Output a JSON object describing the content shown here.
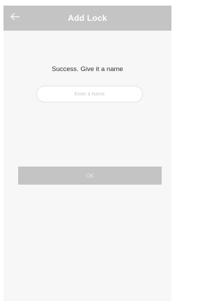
{
  "header": {
    "title": "Add Lock",
    "back_icon": "arrow-left-icon"
  },
  "form": {
    "prompt": "Success. Give it a name",
    "name_placeholder": "Enter a Name",
    "name_value": "",
    "ok_label": "OK"
  },
  "colors": {
    "header_bg": "#c4c4c4",
    "content_bg": "#f7f7f7",
    "button_bg": "#c4c4c4",
    "button_text": "#e8e8e8"
  }
}
